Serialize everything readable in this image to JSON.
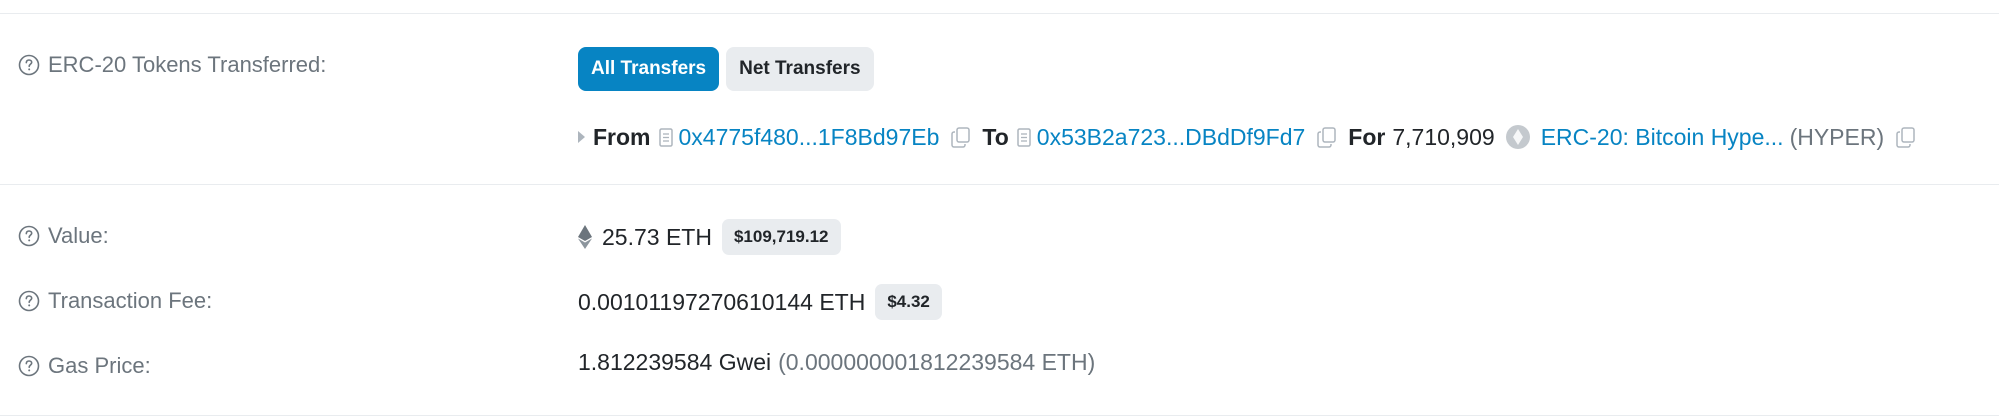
{
  "tokens_transferred": {
    "label": "ERC-20 Tokens Transferred:",
    "tabs": {
      "all": "All Transfers",
      "net": "Net Transfers"
    },
    "transfer": {
      "from_label": "From",
      "from_address": "0x4775f480...1F8Bd97Eb",
      "to_label": "To",
      "to_address": "0x53B2a723...DBdDf9Fd7",
      "for_label": "For",
      "amount": "7,710,909",
      "token_name": "ERC-20: Bitcoin Hype...",
      "token_symbol": "(HYPER)"
    }
  },
  "value": {
    "label": "Value:",
    "amount": "25.73 ETH",
    "usd": "$109,719.12"
  },
  "transaction_fee": {
    "label": "Transaction Fee:",
    "amount": "0.00101197270610144 ETH",
    "usd": "$4.32"
  },
  "gas_price": {
    "label": "Gas Price:",
    "gwei": "1.812239584 Gwei",
    "eth": "(0.000000001812239584 ETH)"
  },
  "colors": {
    "accent": "#0784c3",
    "muted": "#6c757d",
    "badge_bg": "#e9ecef"
  }
}
